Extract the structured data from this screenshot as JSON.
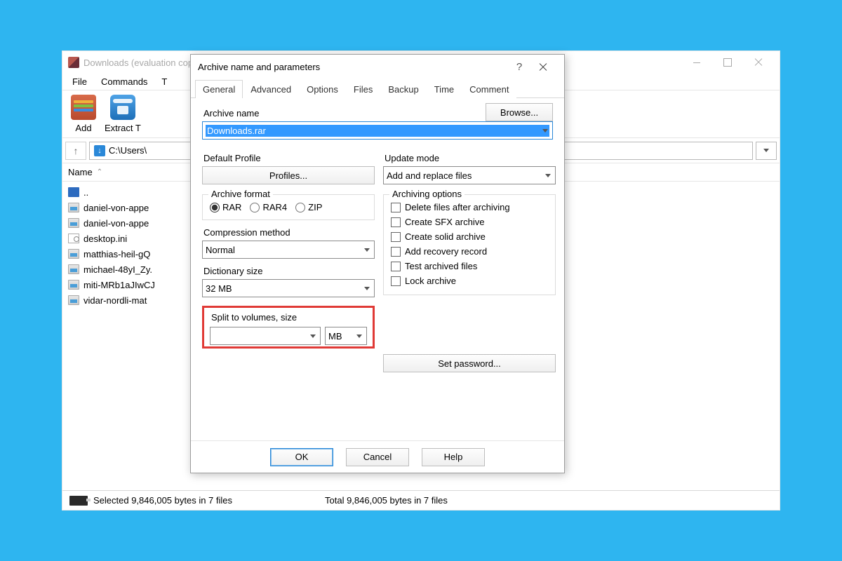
{
  "main": {
    "title": "Downloads (evaluation copy)",
    "menu": [
      "File",
      "Commands",
      "T"
    ],
    "toolbar": {
      "add": "Add",
      "extract": "Extract T"
    },
    "path_value": "C:\\Users\\",
    "list_header": "Name",
    "files": [
      {
        "icon": "dots",
        "name": ".."
      },
      {
        "icon": "img",
        "name": "daniel-von-appe"
      },
      {
        "icon": "img",
        "name": "daniel-von-appe"
      },
      {
        "icon": "ini",
        "name": "desktop.ini"
      },
      {
        "icon": "img",
        "name": "matthias-heil-gQ"
      },
      {
        "icon": "img",
        "name": "michael-48yI_Zy."
      },
      {
        "icon": "img",
        "name": "miti-MRb1aJIwCJ"
      },
      {
        "icon": "img",
        "name": "vidar-nordli-mat"
      }
    ],
    "status_selected": "Selected 9,846,005 bytes in 7 files",
    "status_total": "Total 9,846,005 bytes in 7 files"
  },
  "dialog": {
    "title": "Archive name and parameters",
    "tabs": [
      "General",
      "Advanced",
      "Options",
      "Files",
      "Backup",
      "Time",
      "Comment"
    ],
    "archive_name_label": "Archive name",
    "browse": "Browse...",
    "archive_name_value": "Downloads.rar",
    "default_profile_label": "Default Profile",
    "profiles_btn": "Profiles...",
    "format_group": "Archive format",
    "formats": {
      "rar": "RAR",
      "rar4": "RAR4",
      "zip": "ZIP"
    },
    "comp_method_label": "Compression method",
    "comp_method_value": "Normal",
    "dict_label": "Dictionary size",
    "dict_value": "32 MB",
    "split_label": "Split to volumes, size",
    "split_unit": "MB",
    "update_label": "Update mode",
    "update_value": "Add and replace files",
    "arch_opts_label": "Archiving options",
    "arch_opts": [
      "Delete files after archiving",
      "Create SFX archive",
      "Create solid archive",
      "Add recovery record",
      "Test archived files",
      "Lock archive"
    ],
    "set_password": "Set password...",
    "buttons": {
      "ok": "OK",
      "cancel": "Cancel",
      "help": "Help"
    }
  }
}
